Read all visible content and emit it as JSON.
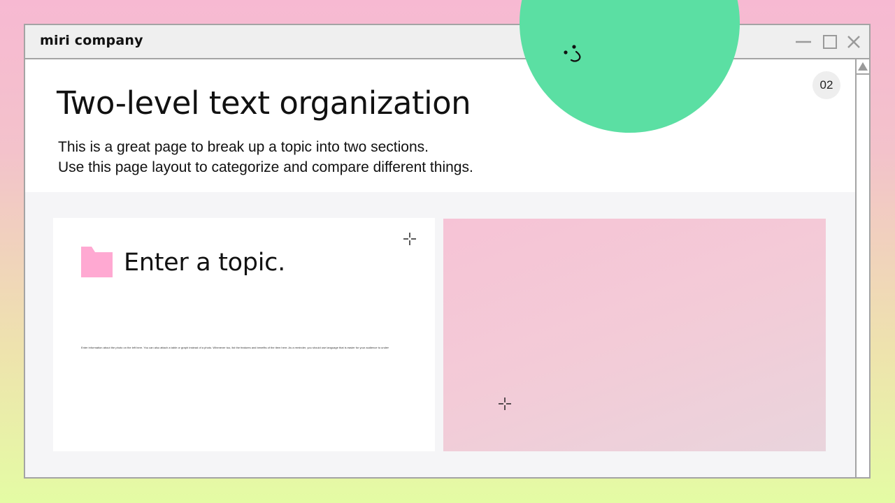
{
  "window": {
    "app_name": "miri company",
    "controls": {
      "minimize_icon": "minimize-icon",
      "maximize_icon": "maximize-icon",
      "close_icon": "close-icon"
    }
  },
  "header": {
    "title": "Two-level text organization",
    "subtitle_lines": [
      "This is a great page to break up a topic into two sections.",
      "Use this page layout to categorize and compare different things."
    ],
    "page_number": "02"
  },
  "card": {
    "icon": "folder-icon",
    "title": "Enter a topic.",
    "body": "Enter information about the photo on the left here. You can also attach a table or graph instead of a photo. Whenever too, list the features and benefits of the item here. As a reminder, you should use language that is easier for your audience to understand than complex sentences."
  },
  "icons": {
    "move": "move-icon",
    "scroll_up": "scroll-up-arrow-icon",
    "smiley": "smiley-face-icon"
  },
  "colors": {
    "background_top": "#f7b9d2",
    "background_bottom": "#e4fca4",
    "accent_green": "#5bdfa3",
    "accent_pink": "#ffa9d2",
    "window_border": "#a4a4a4",
    "image_placeholder": "#f3cbd7"
  }
}
